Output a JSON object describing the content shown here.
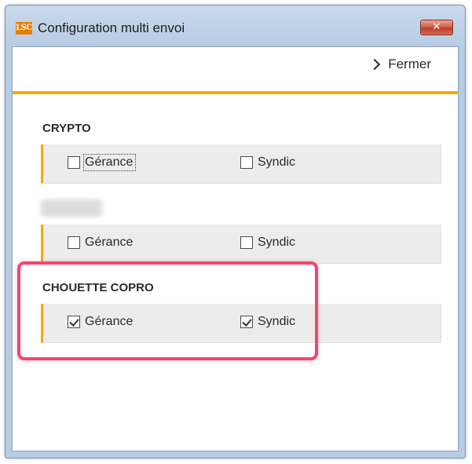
{
  "window": {
    "title": "Configuration multi envoi",
    "logo_text": "LSC",
    "close_glyph": "✕"
  },
  "toolbar": {
    "close_label": "Fermer"
  },
  "colors": {
    "accent": "#f6a800",
    "highlight": "#ef476f"
  },
  "sections": [
    {
      "title": "CRYPTO",
      "options": [
        {
          "label": "Gérance",
          "checked": false
        },
        {
          "label": "Syndic",
          "checked": false
        }
      ]
    },
    {
      "title": "",
      "blurred": true,
      "options": [
        {
          "label": "Gérance",
          "checked": false
        },
        {
          "label": "Syndic",
          "checked": false
        }
      ]
    },
    {
      "title": "CHOUETTE COPRO",
      "options": [
        {
          "label": "Gérance",
          "checked": true
        },
        {
          "label": "Syndic",
          "checked": true
        }
      ]
    }
  ]
}
